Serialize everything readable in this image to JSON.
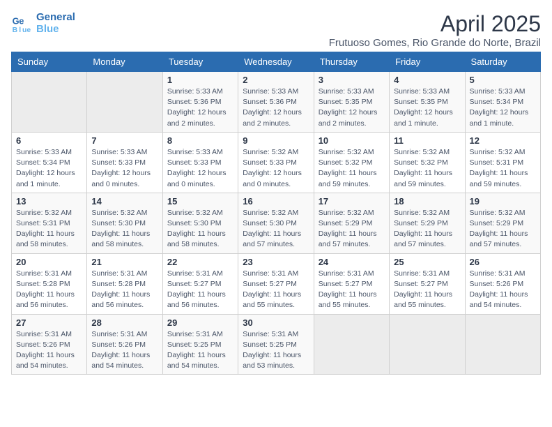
{
  "logo": {
    "line1": "General",
    "line2": "Blue"
  },
  "title": "April 2025",
  "subtitle": "Frutuoso Gomes, Rio Grande do Norte, Brazil",
  "days_of_week": [
    "Sunday",
    "Monday",
    "Tuesday",
    "Wednesday",
    "Thursday",
    "Friday",
    "Saturday"
  ],
  "weeks": [
    [
      {
        "day": "",
        "detail": ""
      },
      {
        "day": "",
        "detail": ""
      },
      {
        "day": "1",
        "detail": "Sunrise: 5:33 AM\nSunset: 5:36 PM\nDaylight: 12 hours\nand 2 minutes."
      },
      {
        "day": "2",
        "detail": "Sunrise: 5:33 AM\nSunset: 5:36 PM\nDaylight: 12 hours\nand 2 minutes."
      },
      {
        "day": "3",
        "detail": "Sunrise: 5:33 AM\nSunset: 5:35 PM\nDaylight: 12 hours\nand 2 minutes."
      },
      {
        "day": "4",
        "detail": "Sunrise: 5:33 AM\nSunset: 5:35 PM\nDaylight: 12 hours\nand 1 minute."
      },
      {
        "day": "5",
        "detail": "Sunrise: 5:33 AM\nSunset: 5:34 PM\nDaylight: 12 hours\nand 1 minute."
      }
    ],
    [
      {
        "day": "6",
        "detail": "Sunrise: 5:33 AM\nSunset: 5:34 PM\nDaylight: 12 hours\nand 1 minute."
      },
      {
        "day": "7",
        "detail": "Sunrise: 5:33 AM\nSunset: 5:33 PM\nDaylight: 12 hours\nand 0 minutes."
      },
      {
        "day": "8",
        "detail": "Sunrise: 5:33 AM\nSunset: 5:33 PM\nDaylight: 12 hours\nand 0 minutes."
      },
      {
        "day": "9",
        "detail": "Sunrise: 5:32 AM\nSunset: 5:33 PM\nDaylight: 12 hours\nand 0 minutes."
      },
      {
        "day": "10",
        "detail": "Sunrise: 5:32 AM\nSunset: 5:32 PM\nDaylight: 11 hours\nand 59 minutes."
      },
      {
        "day": "11",
        "detail": "Sunrise: 5:32 AM\nSunset: 5:32 PM\nDaylight: 11 hours\nand 59 minutes."
      },
      {
        "day": "12",
        "detail": "Sunrise: 5:32 AM\nSunset: 5:31 PM\nDaylight: 11 hours\nand 59 minutes."
      }
    ],
    [
      {
        "day": "13",
        "detail": "Sunrise: 5:32 AM\nSunset: 5:31 PM\nDaylight: 11 hours\nand 58 minutes."
      },
      {
        "day": "14",
        "detail": "Sunrise: 5:32 AM\nSunset: 5:30 PM\nDaylight: 11 hours\nand 58 minutes."
      },
      {
        "day": "15",
        "detail": "Sunrise: 5:32 AM\nSunset: 5:30 PM\nDaylight: 11 hours\nand 58 minutes."
      },
      {
        "day": "16",
        "detail": "Sunrise: 5:32 AM\nSunset: 5:30 PM\nDaylight: 11 hours\nand 57 minutes."
      },
      {
        "day": "17",
        "detail": "Sunrise: 5:32 AM\nSunset: 5:29 PM\nDaylight: 11 hours\nand 57 minutes."
      },
      {
        "day": "18",
        "detail": "Sunrise: 5:32 AM\nSunset: 5:29 PM\nDaylight: 11 hours\nand 57 minutes."
      },
      {
        "day": "19",
        "detail": "Sunrise: 5:32 AM\nSunset: 5:29 PM\nDaylight: 11 hours\nand 57 minutes."
      }
    ],
    [
      {
        "day": "20",
        "detail": "Sunrise: 5:31 AM\nSunset: 5:28 PM\nDaylight: 11 hours\nand 56 minutes."
      },
      {
        "day": "21",
        "detail": "Sunrise: 5:31 AM\nSunset: 5:28 PM\nDaylight: 11 hours\nand 56 minutes."
      },
      {
        "day": "22",
        "detail": "Sunrise: 5:31 AM\nSunset: 5:27 PM\nDaylight: 11 hours\nand 56 minutes."
      },
      {
        "day": "23",
        "detail": "Sunrise: 5:31 AM\nSunset: 5:27 PM\nDaylight: 11 hours\nand 55 minutes."
      },
      {
        "day": "24",
        "detail": "Sunrise: 5:31 AM\nSunset: 5:27 PM\nDaylight: 11 hours\nand 55 minutes."
      },
      {
        "day": "25",
        "detail": "Sunrise: 5:31 AM\nSunset: 5:27 PM\nDaylight: 11 hours\nand 55 minutes."
      },
      {
        "day": "26",
        "detail": "Sunrise: 5:31 AM\nSunset: 5:26 PM\nDaylight: 11 hours\nand 54 minutes."
      }
    ],
    [
      {
        "day": "27",
        "detail": "Sunrise: 5:31 AM\nSunset: 5:26 PM\nDaylight: 11 hours\nand 54 minutes."
      },
      {
        "day": "28",
        "detail": "Sunrise: 5:31 AM\nSunset: 5:26 PM\nDaylight: 11 hours\nand 54 minutes."
      },
      {
        "day": "29",
        "detail": "Sunrise: 5:31 AM\nSunset: 5:25 PM\nDaylight: 11 hours\nand 54 minutes."
      },
      {
        "day": "30",
        "detail": "Sunrise: 5:31 AM\nSunset: 5:25 PM\nDaylight: 11 hours\nand 53 minutes."
      },
      {
        "day": "",
        "detail": ""
      },
      {
        "day": "",
        "detail": ""
      },
      {
        "day": "",
        "detail": ""
      }
    ]
  ]
}
